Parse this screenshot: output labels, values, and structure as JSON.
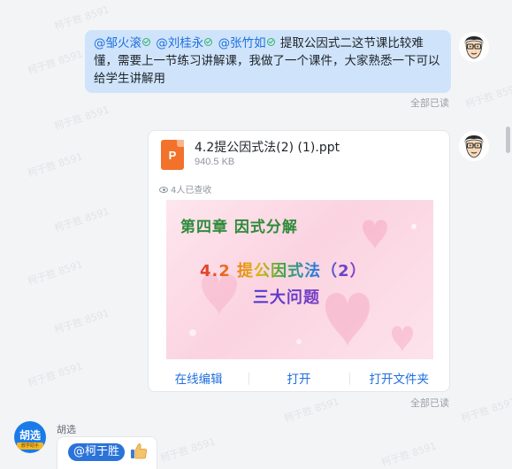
{
  "watermark": "柯于胜 8591",
  "message1": {
    "mentions": [
      "@邹火滚",
      "@刘桂永",
      "@张竹如"
    ],
    "text": "提取公因式二这节课比较难懂，需要上一节练习讲解课，我做了一个课件，大家熟悉一下可以给学生讲解用",
    "read_status": "全部已读"
  },
  "file_message": {
    "file_icon_letter": "P",
    "file_name": "4.2提公因式法(2) (1).ppt",
    "file_size": "940.5 KB",
    "views": "4人已查收",
    "slide": {
      "chapter": "第四章 因式分解",
      "subtitle1": "4.2  提公因式法（2）",
      "subtitle2": "三大问题"
    },
    "actions": [
      "在线编辑",
      "打开",
      "打开文件夹"
    ],
    "read_status": "全部已读"
  },
  "bot_message": {
    "avatar_label": "胡选",
    "avatar_tag": "教学助手",
    "sender": "胡选",
    "mention": "@柯于胜",
    "emoji": "thumbs-up-icon"
  },
  "colors": {
    "bubble_blue": "#cfe4fb",
    "link_blue": "#1f6fde",
    "ppt_orange": "#f2722b",
    "mention_chip": "#2a73d9"
  }
}
